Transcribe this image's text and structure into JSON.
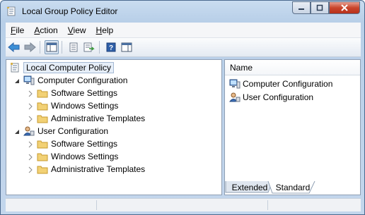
{
  "window": {
    "title": "Local Group Policy Editor"
  },
  "menu": [
    {
      "key": "F",
      "rest": "ile"
    },
    {
      "key": "A",
      "rest": "ction"
    },
    {
      "key": "V",
      "rest": "iew"
    },
    {
      "key": "H",
      "rest": "elp"
    }
  ],
  "toolbar": {
    "icons": [
      "back-arrow-icon",
      "forward-arrow-icon",
      "show-hide-console-tree-icon",
      "properties-icon",
      "export-list-icon",
      "help-icon",
      "show-action-pane-icon"
    ]
  },
  "tree": {
    "root": "Local Computer Policy",
    "computer": {
      "label": "Computer Configuration",
      "children": [
        "Software Settings",
        "Windows Settings",
        "Administrative Templates"
      ]
    },
    "user": {
      "label": "User Configuration",
      "children": [
        "Software Settings",
        "Windows Settings",
        "Administrative Templates"
      ]
    }
  },
  "list": {
    "column_header": "Name",
    "items": [
      "Computer Configuration",
      "User Configuration"
    ]
  },
  "tabs": {
    "extended": "Extended",
    "standard": "Standard",
    "active": "Standard"
  },
  "colors": {
    "accent_blue": "#3c6fb4",
    "folder_yellow": "#f2d175",
    "close_red": "#c9452b"
  }
}
